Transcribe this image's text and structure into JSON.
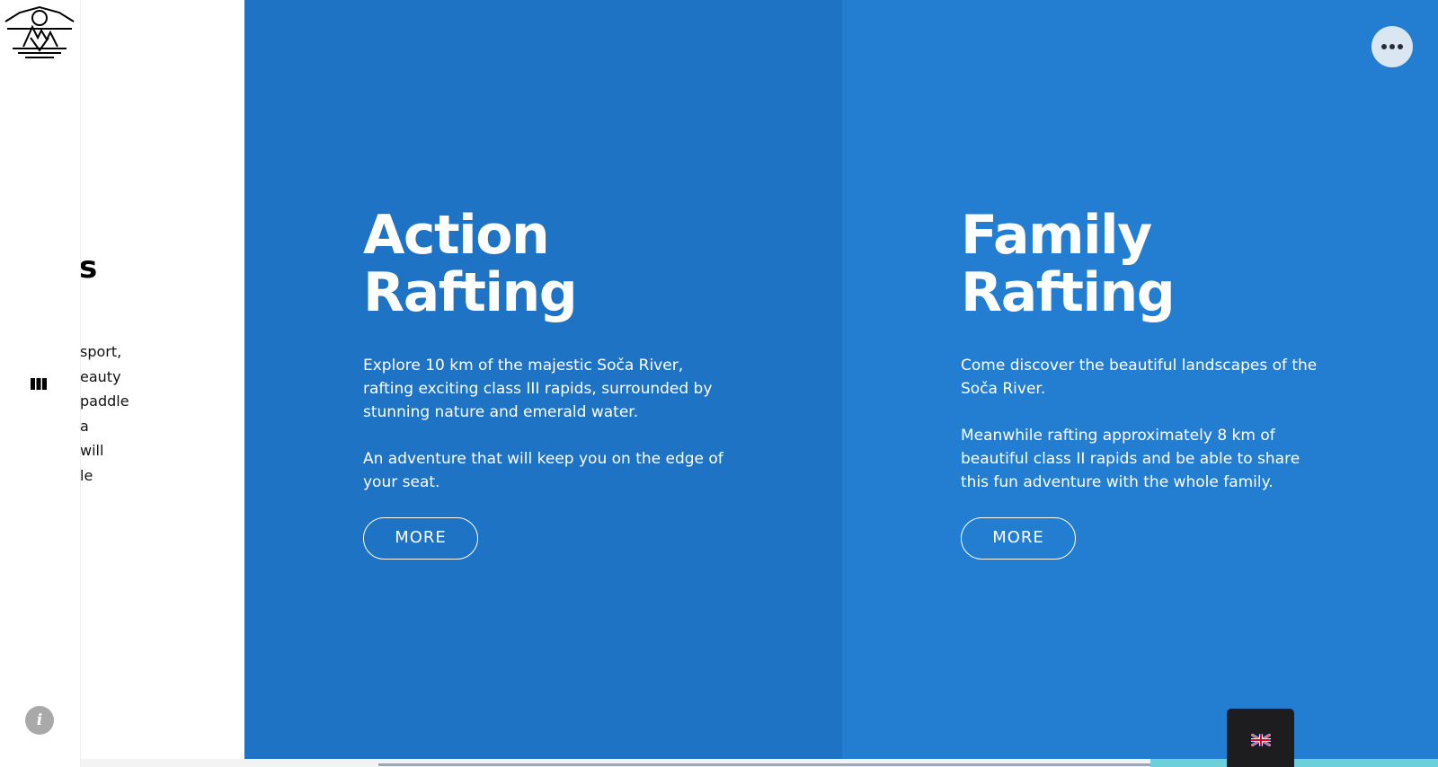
{
  "left_panel": {
    "heading_fragment": "s",
    "text_fragment": " sport,\neauty\npaddle\n a\nwill\nle"
  },
  "cards": [
    {
      "title_line1": "Action",
      "title_line2": "Rafting",
      "paragraph1": "Explore 10 km of the majestic Soča River, rafting exciting class III rapids, surrounded by stunning nature and emerald water.",
      "paragraph2": "An adventure that will keep you on the edge of your seat.",
      "button_label": "MORE"
    },
    {
      "title_line1": "Family",
      "title_line2": "Rafting",
      "paragraph1": "Come discover the beautiful landscapes of the Soča River.",
      "paragraph2": "Meanwhile rafting approximately 8 km of beautiful class II rapids and be able to share this fun adventure with the whole family.",
      "button_label": "MORE"
    }
  ],
  "info_icon_glyph": "i",
  "icons": {
    "logo": "mountain-sun-logo",
    "sections": "grid-icon",
    "info": "info-icon",
    "menu": "more-dots-icon",
    "language": "uk-flag-icon"
  },
  "colors": {
    "action_card": "#1e73c4",
    "family_card": "#237ed2",
    "accent": "#6dcfd8",
    "lang_switch_bg": "#1d1d1f"
  }
}
